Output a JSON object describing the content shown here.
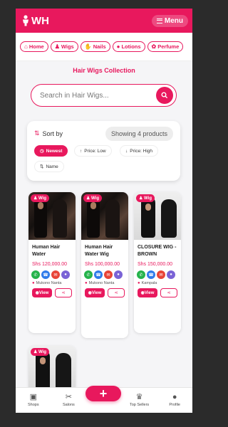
{
  "header": {
    "brand": "WH",
    "menu_label": "Menu"
  },
  "categories": [
    {
      "label": "Home",
      "icon": "home-icon"
    },
    {
      "label": "Wigs",
      "icon": "wig-icon"
    },
    {
      "label": "Nails",
      "icon": "nails-icon"
    },
    {
      "label": "Lotions",
      "icon": "lotion-icon"
    },
    {
      "label": "Perfume",
      "icon": "perfume-icon"
    }
  ],
  "section_title": "Hair Wigs Collection",
  "search": {
    "placeholder": "Search in Hair Wigs..."
  },
  "sort": {
    "label": "Sort by",
    "showing": "Showing 4 products",
    "options": [
      {
        "label": "Newest",
        "active": true
      },
      {
        "label": "Price: Low",
        "active": false
      },
      {
        "label": "Price: High",
        "active": false
      },
      {
        "label": "Name",
        "active": false
      }
    ]
  },
  "products": [
    {
      "tag": "Wig",
      "name": "Human Hair Water",
      "price": "Shs 120,000.00",
      "location": "Mukono Nanta",
      "view": "View"
    },
    {
      "tag": "Wig",
      "name": "Human Hair Water Wig",
      "price": "Shs 100,000.00",
      "location": "Mukono Nanta",
      "view": "View"
    },
    {
      "tag": "Wig",
      "name": "CLOSURE WIG - BROWN",
      "price": "Shs 150,000.00",
      "location": "Kampala",
      "view": "View"
    },
    {
      "tag": "Wig",
      "name": "",
      "price": "",
      "location": "",
      "view": ""
    }
  ],
  "bottom_nav": {
    "shops": "Shops",
    "salons": "Salons",
    "top_sellers": "Top Sellers",
    "profile": "Profile",
    "fab_label": "+"
  },
  "colors": {
    "accent": "#e8185d",
    "background": "#f5f5f7"
  }
}
